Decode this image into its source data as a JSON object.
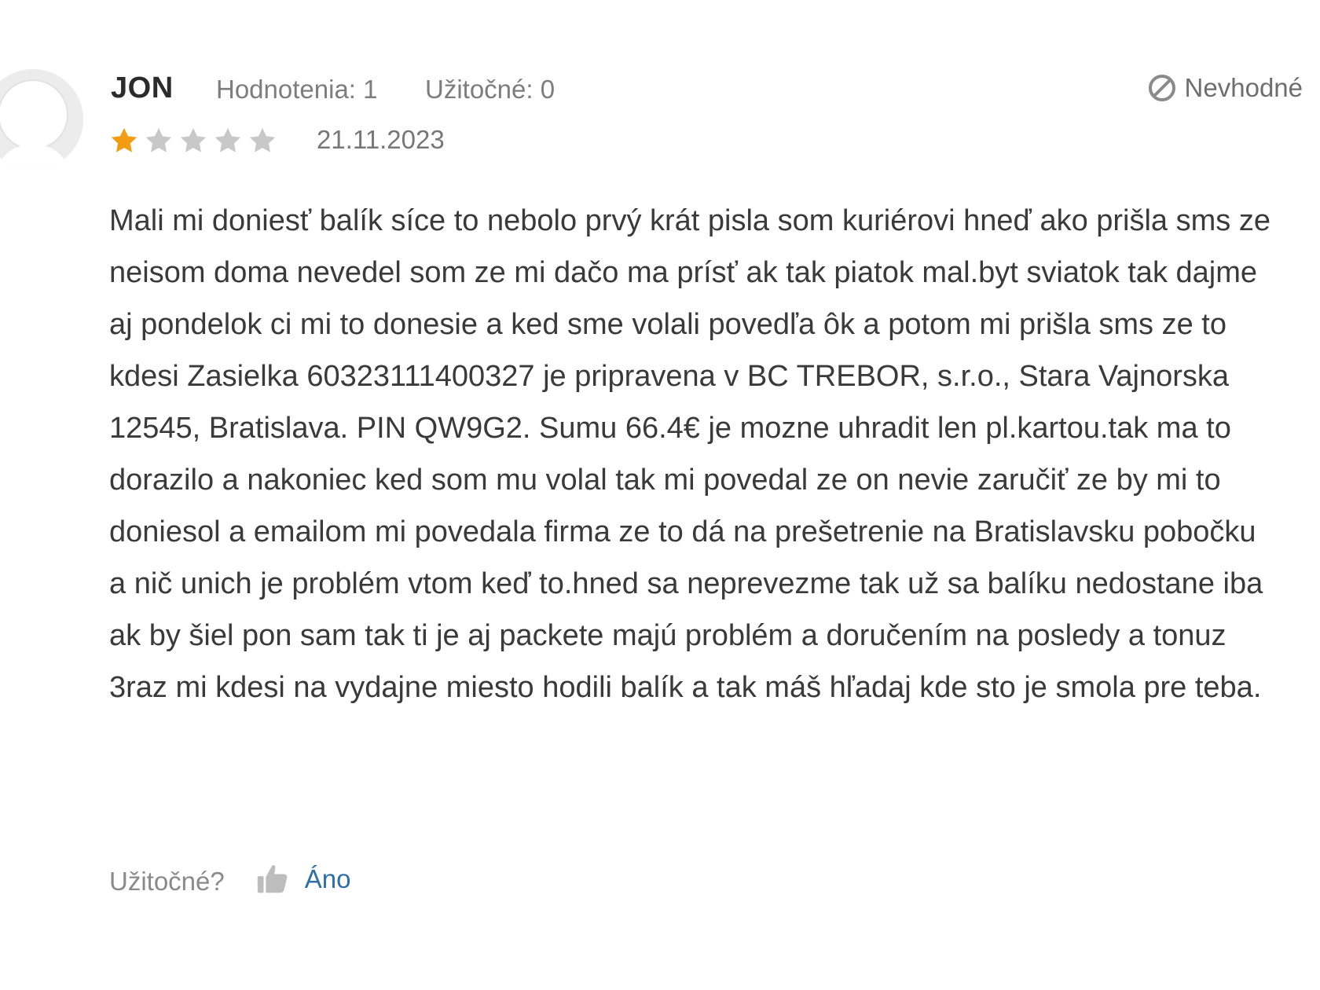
{
  "review": {
    "author": "JON",
    "ratings_count_label": "Hodnotenia: 1",
    "useful_count_label": "Užitočné: 0",
    "report_label": "Nevhodné",
    "rating": {
      "value": 1,
      "max": 5
    },
    "date": "21.11.2023",
    "text": "Mali mi doniesť balík síce to nebolo prvý krát pisla som kuriérovi hneď ako prišla sms ze neisom doma nevedel som ze mi dačo ma prísť ak tak piatok mal.byt sviatok tak dajme aj pondelok ci mi to donesie a ked sme volali povedľa ôk a potom mi prišla sms ze to kdesi Zasielka 60323111400327 je pripravena v BC TREBOR, s.r.o., Stara Vajnorska 12545, Bratislava. PIN QW9G2. Sumu 66.4€ je mozne uhradit len pl.kartou.tak ma to dorazilo a nakoniec ked som mu volal tak mi povedal ze on nevie zaručiť ze by mi to doniesol a emailom mi povedala firma ze to dá na prešetrenie na Bratislavsku pobočku a nič unich je problém vtom keď to.hned sa neprevezme tak už sa balíku nedostane iba ak by šiel pon sam tak ti je aj packete majú problém a doručením na posledy a tonuz 3raz mi kdesi na vydajne miesto hodili balík a tak máš hľadaj kde sto je smola pre teba.",
    "useful_question": "Užitočné?",
    "useful_yes_label": "Áno"
  },
  "colors": {
    "star_filled": "#f39c12",
    "star_empty": "#c8c8c8",
    "link": "#2f6fa8",
    "muted_text": "#7d7d7d"
  },
  "icons": {
    "avatar": "user-silhouette-icon",
    "report": "prohibited-circle-icon",
    "useful": "thumbs-up-icon"
  }
}
